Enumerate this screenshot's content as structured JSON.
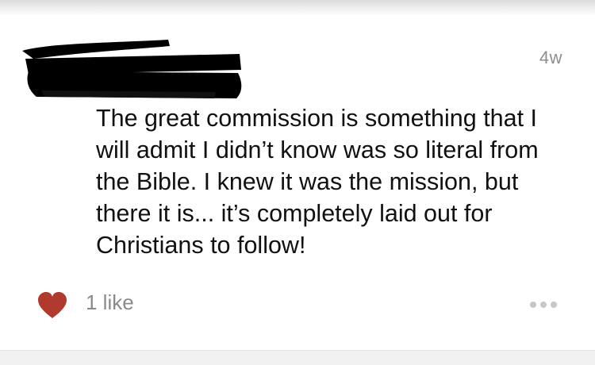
{
  "post": {
    "timestamp": "4w",
    "text": "The great commission is something that I will admit I didn’t know was so literal from the Bible. I knew it was the mission, but there it is... it’s completely laid out for Christians to follow!",
    "likes_label": "1 like"
  },
  "icons": {
    "like": "heart-icon",
    "more": "more-dots-icon"
  },
  "colors": {
    "heart": "#b03a2e",
    "muted_text": "#8a8a8a",
    "dots": "#c7c7c7"
  }
}
